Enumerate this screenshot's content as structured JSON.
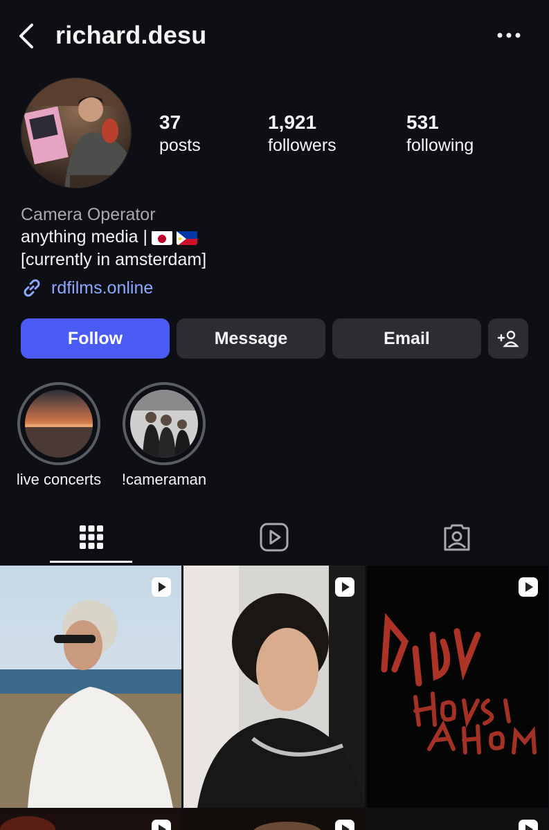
{
  "header": {
    "username": "richard.desu",
    "back_icon": "chevron-left-icon",
    "more_icon": "more-horizontal-icon"
  },
  "profile": {
    "stats": [
      {
        "value": "37",
        "label": "posts"
      },
      {
        "value": "1,921",
        "label": "followers"
      },
      {
        "value": "531",
        "label": "following"
      }
    ],
    "category": "Camera Operator",
    "bio_line1": "anything media |",
    "bio_line2": "[currently in amsterdam]",
    "link": "rdfilms.online"
  },
  "actions": {
    "follow": "Follow",
    "message": "Message",
    "email": "Email",
    "add_icon": "add-person-icon"
  },
  "highlights": [
    {
      "label": "live concerts"
    },
    {
      "label": "!cameraman"
    }
  ],
  "tabs": [
    {
      "icon": "grid-icon",
      "active": true
    },
    {
      "icon": "reels-icon",
      "active": false
    },
    {
      "icon": "tagged-icon",
      "active": false
    }
  ],
  "colors": {
    "background": "#0d0f14",
    "accent": "#4a5cf5",
    "link": "#8ea7ff",
    "button_secondary": "#2b2d33"
  }
}
